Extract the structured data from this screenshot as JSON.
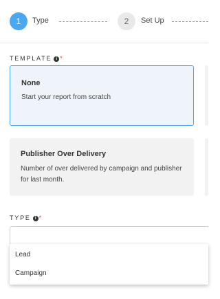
{
  "stepper": {
    "steps": [
      {
        "number": "1",
        "label": "Type",
        "status": "active"
      },
      {
        "number": "2",
        "label": "Set Up",
        "status": "inactive"
      }
    ]
  },
  "template": {
    "label": "TEMPLATE",
    "info_glyph": "i",
    "required_marker": "*",
    "cards": [
      {
        "title": "None",
        "description": "Start your report from scratch",
        "selected": true
      },
      {
        "title": "Publisher Over Delivery",
        "description": "Number of over delivered by campaign and publisher for last month.",
        "selected": false
      }
    ]
  },
  "type": {
    "label": "TYPE",
    "info_glyph": "i",
    "required_marker": "*",
    "value": "",
    "options": [
      "Lead",
      "Campaign"
    ]
  },
  "colors": {
    "accent": "#4aa8f2",
    "required": "#e53935",
    "card_background": "#f2f2f2",
    "selected_card_background": "#eef4fa"
  }
}
